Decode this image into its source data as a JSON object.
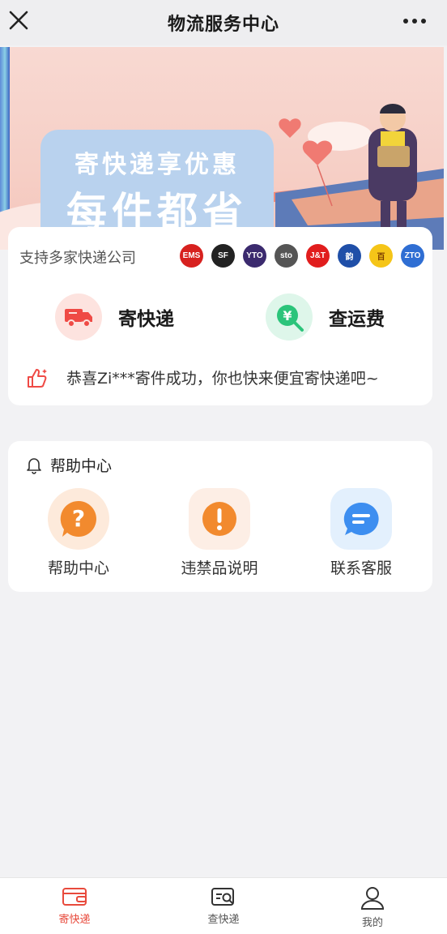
{
  "header": {
    "title": "物流服务中心",
    "close_icon": "close-icon",
    "more_icon": "more-icon"
  },
  "banner": {
    "line1": "寄快递享优惠",
    "line2": "每件都省"
  },
  "support": {
    "label": "支持多家快递公司",
    "carriers": [
      {
        "name": "EMS",
        "mark": "EMS",
        "color": "#d7211f"
      },
      {
        "name": "SF",
        "mark": "SF",
        "color": "#222222"
      },
      {
        "name": "YTO",
        "mark": "YTO",
        "color": "#3b2a6e"
      },
      {
        "name": "STO",
        "mark": "sto",
        "color": "#555555"
      },
      {
        "name": "J&T",
        "mark": "J&T",
        "color": "#e11d1d"
      },
      {
        "name": "Yunda",
        "mark": "韵",
        "color": "#1f4fa8"
      },
      {
        "name": "Best",
        "mark": "百",
        "color": "#f5c518"
      },
      {
        "name": "ZTO",
        "mark": "ZTO",
        "color": "#2f6ed3"
      }
    ]
  },
  "actions": {
    "send_label": "寄快递",
    "fee_label": "查运费"
  },
  "ticker": {
    "text": "恭喜Zi***寄件成功，你也快来便宜寄快递吧~"
  },
  "help": {
    "title": "帮助中心",
    "items": [
      {
        "label": "帮助中心"
      },
      {
        "label": "违禁品说明"
      },
      {
        "label": "联系客服"
      }
    ]
  },
  "tabs": [
    {
      "label": "寄快递",
      "active": true
    },
    {
      "label": "查快递",
      "active": false
    },
    {
      "label": "我的",
      "active": false
    }
  ],
  "colors": {
    "accent": "#e84a3c",
    "green": "#2bc47a",
    "orange": "#f28a2e",
    "blue": "#3d8ef0"
  }
}
